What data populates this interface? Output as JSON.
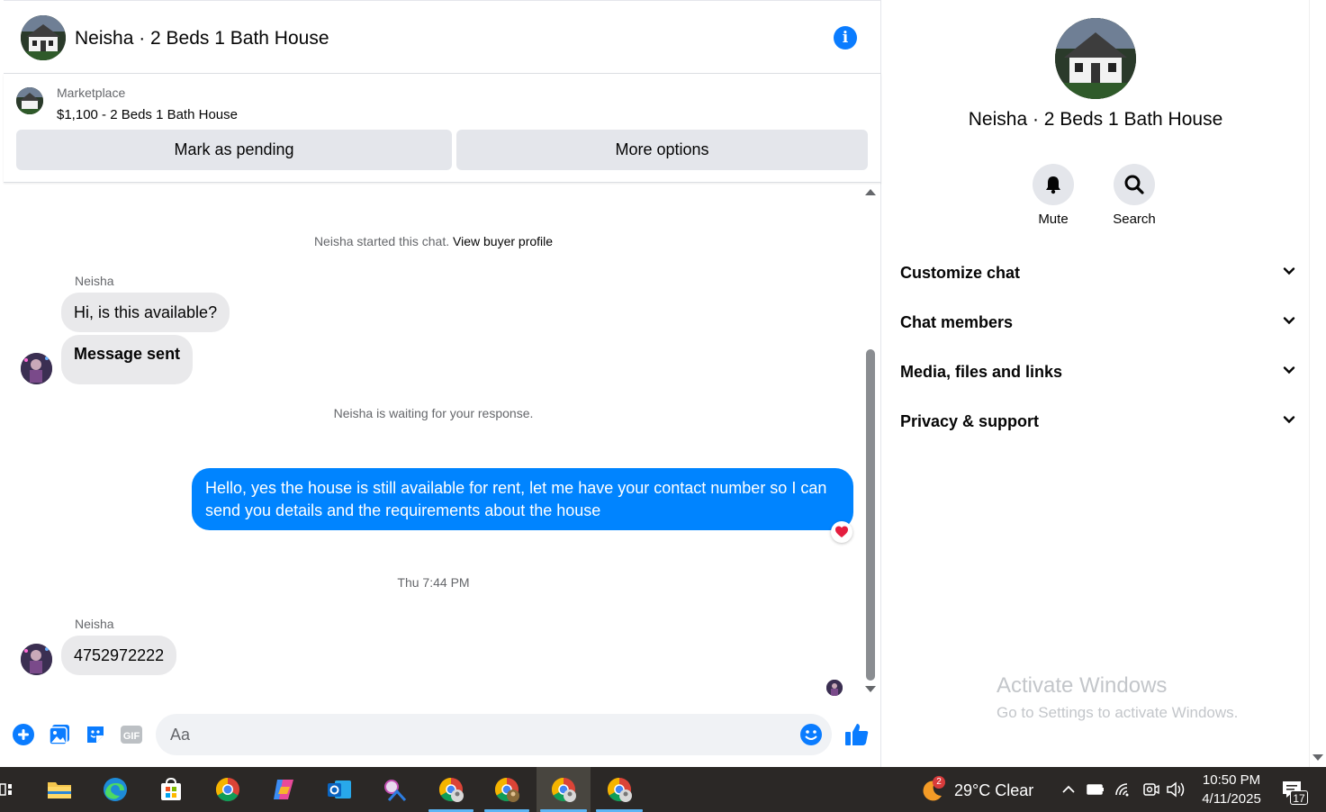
{
  "header": {
    "title": "Neisha · 2 Beds 1 Bath House",
    "info_icon_glyph": "i"
  },
  "listing": {
    "source": "Marketplace",
    "price_title": "$1,100 - 2 Beds 1 Bath House",
    "pending_label": "Mark as pending",
    "more_label": "More options"
  },
  "messages": {
    "started_text": "Neisha started this chat.",
    "buyer_profile_link": "View buyer profile",
    "sender_1": "Neisha",
    "msg_1": "Hi, is this available?",
    "msg_2": "Message sent",
    "waiting_text": "Neisha is waiting for your response.",
    "outgoing": "Hello, yes the house is still available for rent, let me have your contact number so I can send you details and the requirements about the house",
    "timestamp": "Thu 7:44 PM",
    "sender_2": "Neisha",
    "msg_3": "4752972222"
  },
  "composer": {
    "placeholder": "Aa",
    "icons": [
      "plus-icon",
      "photo-icon",
      "sticker-icon",
      "gif-icon",
      "emoji-icon",
      "thumbs-up-icon"
    ],
    "gif_label": "GIF"
  },
  "info_panel": {
    "name": "Neisha · 2 Beds 1 Bath House",
    "mute_label": "Mute",
    "search_label": "Search",
    "sections": [
      {
        "label": "Customize chat"
      },
      {
        "label": "Chat members"
      },
      {
        "label": "Media, files and links"
      },
      {
        "label": "Privacy & support"
      }
    ]
  },
  "watermark": {
    "title": "Activate Windows",
    "subtitle": "Go to Settings to activate Windows."
  },
  "taskbar": {
    "weather_badge": "2",
    "weather": "29°C  Clear",
    "time": "10:50 PM",
    "date": "4/11/2025",
    "notification_count": "17"
  },
  "colors": {
    "accent": "#0084ff",
    "bubble_in": "#e9e9eb",
    "button_bg": "#e4e6eb",
    "taskbar": "#2b2826",
    "heart": "#e41e3f"
  }
}
